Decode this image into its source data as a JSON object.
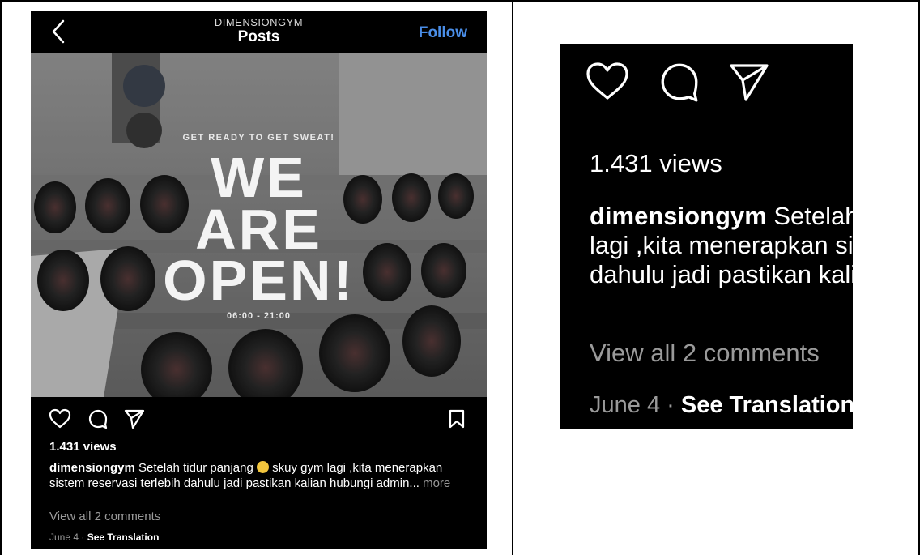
{
  "header": {
    "account": "DIMENSIONGYM",
    "title": "Posts",
    "follow_label": "Follow"
  },
  "post_image": {
    "tagline": "GET READY TO GET SWEAT!",
    "line1": "WE",
    "line2": "ARE",
    "line3": "OPEN!",
    "hours": "06:00 - 21:00"
  },
  "post": {
    "views": "1.431 views",
    "username": "dimensiongym",
    "caption_part1": " Setelah tidur panjang ",
    "caption_part2": " skuy gym lagi ,kita menerapkan sistem reservasi terlebih dahulu jadi pastikan kalian hubungi admin... ",
    "more_label": "more",
    "view_comments": "View all 2 comments",
    "date": "June 4",
    "separator": " · ",
    "translate_label": "See Translation"
  },
  "zoom": {
    "views": "1.431 views",
    "username": "dimensiongym",
    "line1_rest": " Setelah t",
    "line2": "lagi ,kita menerapkan sis",
    "line3": "dahulu jadi pastikan kalia",
    "view_comments": "View all 2 comments",
    "date": "June 4",
    "separator": " · ",
    "translate_label": "See Translation"
  },
  "icons": {
    "back": "chevron-left-icon",
    "like": "heart-icon",
    "comment": "comment-bubble-icon",
    "share": "paper-plane-icon",
    "save": "bookmark-icon",
    "emoji": "sleepy-face-emoji"
  },
  "colors": {
    "background": "#000000",
    "follow_blue": "#4a8ee8",
    "muted_text": "#9a9a9a"
  }
}
